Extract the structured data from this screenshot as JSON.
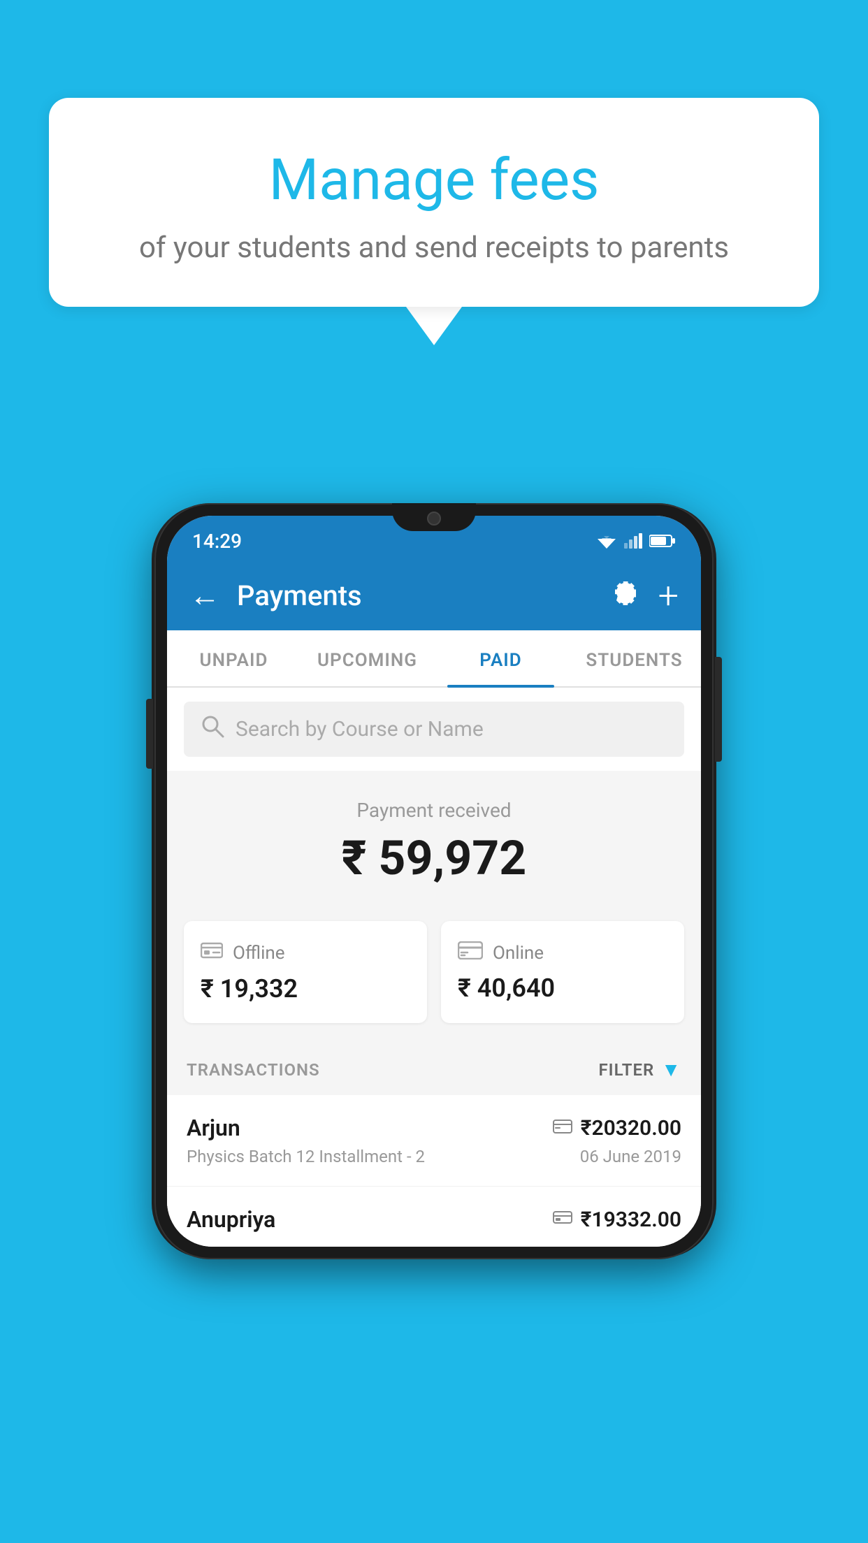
{
  "background_color": "#1eb8e8",
  "speech_bubble": {
    "title": "Manage fees",
    "subtitle": "of your students and send receipts to parents"
  },
  "status_bar": {
    "time": "14:29",
    "wifi_icon": "▼",
    "battery_icon": "▮"
  },
  "app_bar": {
    "title": "Payments",
    "back_label": "←",
    "settings_label": "⚙",
    "add_label": "+"
  },
  "tabs": [
    {
      "id": "unpaid",
      "label": "UNPAID",
      "active": false
    },
    {
      "id": "upcoming",
      "label": "UPCOMING",
      "active": false
    },
    {
      "id": "paid",
      "label": "PAID",
      "active": true
    },
    {
      "id": "students",
      "label": "STUDENTS",
      "active": false
    }
  ],
  "search": {
    "placeholder": "Search by Course or Name"
  },
  "payment_summary": {
    "label": "Payment received",
    "amount": "₹ 59,972",
    "offline_label": "Offline",
    "offline_amount": "₹ 19,332",
    "online_label": "Online",
    "online_amount": "₹ 40,640"
  },
  "transactions": {
    "header_label": "TRANSACTIONS",
    "filter_label": "FILTER",
    "items": [
      {
        "name": "Arjun",
        "course": "Physics Batch 12 Installment - 2",
        "amount": "₹20320.00",
        "date": "06 June 2019",
        "type": "online"
      },
      {
        "name": "Anupriya",
        "course": "",
        "amount": "₹19332.00",
        "date": "",
        "type": "offline"
      }
    ]
  }
}
